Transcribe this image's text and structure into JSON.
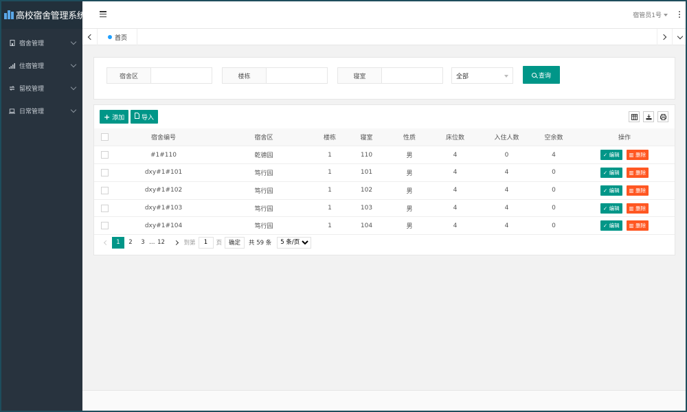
{
  "app": {
    "title": "高校宿舍管理系统"
  },
  "sidebar": {
    "items": [
      {
        "label": "宿舍管理",
        "icon": "building-icon"
      },
      {
        "label": "住宿管理",
        "icon": "signal-icon"
      },
      {
        "label": "留校管理",
        "icon": "refresh-icon"
      },
      {
        "label": "日常管理",
        "icon": "laptop-icon"
      }
    ]
  },
  "header": {
    "user": "宿管员1号"
  },
  "tabs": {
    "home": "首页"
  },
  "search": {
    "fields": [
      {
        "label": "宿舍区",
        "value": ""
      },
      {
        "label": "楼栋",
        "value": ""
      },
      {
        "label": "寝室",
        "value": ""
      }
    ],
    "select_value": "全部",
    "button_label": "查询"
  },
  "toolbar": {
    "add_label": "添加",
    "import_label": "导入"
  },
  "table": {
    "columns": [
      "宿舍编号",
      "宿舍区",
      "楼栋",
      "寝室",
      "性质",
      "床位数",
      "入住人数",
      "空余数",
      "操作"
    ],
    "rows": [
      [
        "#1#110",
        "乾德园",
        "1",
        "110",
        "男",
        "4",
        "0",
        "4"
      ],
      [
        "dxy#1#101",
        "笃行园",
        "1",
        "101",
        "男",
        "4",
        "4",
        "0"
      ],
      [
        "dxy#1#102",
        "笃行园",
        "1",
        "102",
        "男",
        "4",
        "4",
        "0"
      ],
      [
        "dxy#1#103",
        "笃行园",
        "1",
        "103",
        "男",
        "4",
        "4",
        "0"
      ],
      [
        "dxy#1#104",
        "笃行园",
        "1",
        "104",
        "男",
        "4",
        "4",
        "0"
      ]
    ],
    "edit_label": "编辑",
    "delete_label": "删除"
  },
  "pagination": {
    "pages": [
      "1",
      "2",
      "3"
    ],
    "ellipsis": "…",
    "last_page": "12",
    "goto_label": "到第",
    "goto_value": "1",
    "page_unit": "页",
    "confirm_label": "确定",
    "total_label": "共 59 条",
    "page_size": "5 条/页"
  },
  "colors": {
    "primary": "#009688",
    "danger": "#ff5722",
    "sidebar": "#28333e"
  }
}
